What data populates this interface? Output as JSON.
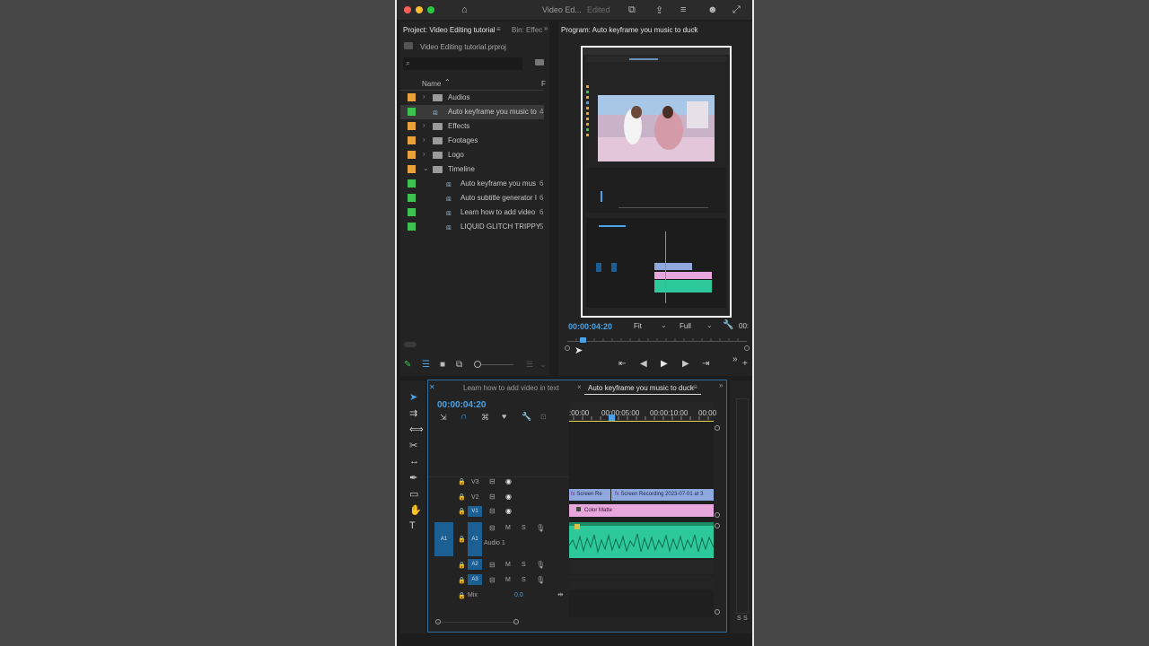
{
  "window": {
    "title": "Video Ed...",
    "status": "Edited"
  },
  "project_panel": {
    "tab_label": "Project: Video Editing tutorial",
    "bin_tab_label": "Bin: Effec",
    "file_name": "Video Editing tutorial.prproj",
    "search_placeholder": "",
    "column_name": "Name",
    "column_f": "F",
    "items": [
      {
        "label": "Audios",
        "color": "#e8a23a",
        "type": "folder",
        "expanded": false
      },
      {
        "label": "Auto keyframe you music to",
        "color": "#3ec24f",
        "type": "sequence",
        "selected": true,
        "tail": "4"
      },
      {
        "label": "Effects",
        "color": "#e8a23a",
        "type": "folder",
        "expanded": false
      },
      {
        "label": "Footages",
        "color": "#e8a23a",
        "type": "folder",
        "expanded": false
      },
      {
        "label": "Logo",
        "color": "#e8a23a",
        "type": "folder",
        "expanded": false
      },
      {
        "label": "Timeline",
        "color": "#e8a23a",
        "type": "folder",
        "expanded": true
      },
      {
        "label": "Auto keyframe you mus",
        "color": "#3ec24f",
        "type": "sequence",
        "tail": "6"
      },
      {
        "label": "Auto subtitle generator I",
        "color": "#3ec24f",
        "type": "sequence",
        "tail": "6"
      },
      {
        "label": "Learn how to add video",
        "color": "#3ec24f",
        "type": "sequence",
        "tail": "6"
      },
      {
        "label": "LIQUID GLITCH TRIPPY",
        "color": "#3ec24f",
        "type": "sequence",
        "tail": "5"
      }
    ]
  },
  "program_panel": {
    "tab_label": "Program: Auto keyframe you music to duck",
    "timecode": "00:00:04:20",
    "fit_label": "Fit",
    "quality_label": "Full",
    "duration_partial": "00:",
    "playhead_fraction": 0.07
  },
  "timeline_panel": {
    "tab_inactive": "Learn how to add video in text",
    "tab_active": "Auto keyframe you music to duck",
    "timecode": "00:00:04:20",
    "ruler_labels": [
      ":00:00",
      "00:00:05:00",
      "00:00:10:00",
      "00:00"
    ],
    "tracks": {
      "v3": "V3",
      "v2": "V2",
      "v1": "V1",
      "a1": "A1",
      "a2": "A2",
      "a3": "A3",
      "audio1_name": "Audio 1",
      "mix_label": "Mix",
      "mix_value": "0.0",
      "m_label": "M",
      "s_label": "S"
    },
    "clips": {
      "v2_clip1": "Screen Re",
      "v2_clip2": "Screen Recording 2023-07-01 at 3",
      "v1_clip": "Color Matte",
      "fx_badge": "fx"
    }
  },
  "colors": {
    "accent_blue": "#4aa3e8",
    "label_orange": "#e8a23a",
    "label_green": "#3ec24f",
    "v1_clip": "#e7a6dc",
    "v2_clip": "#8fa8dd",
    "audio_clip": "#2ec99a"
  }
}
